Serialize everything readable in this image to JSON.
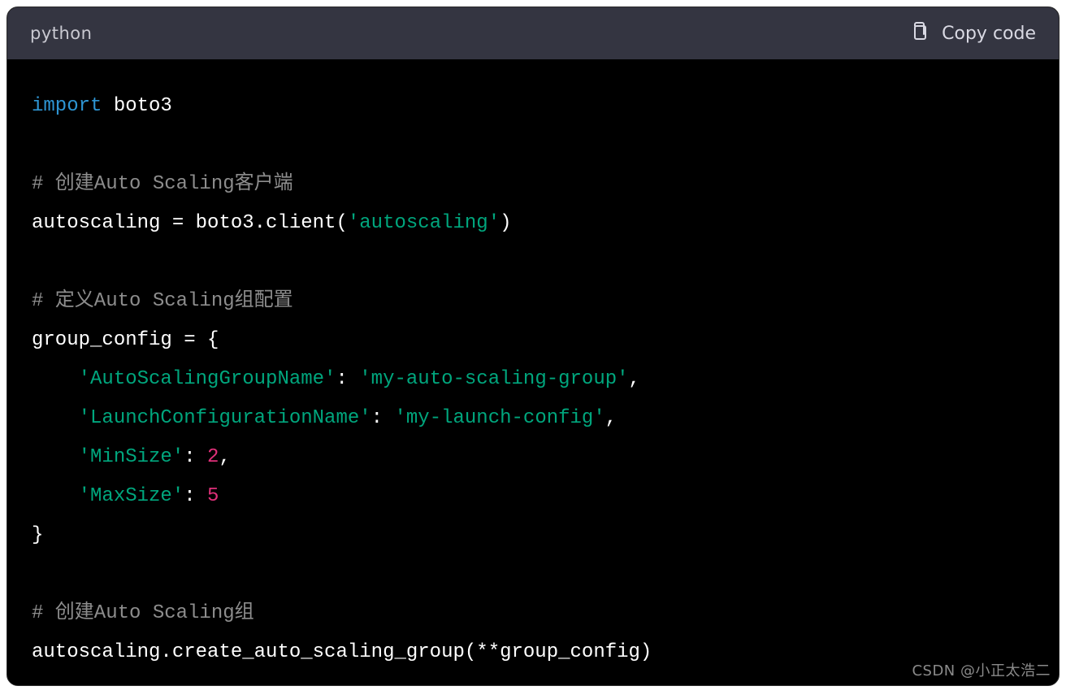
{
  "header": {
    "language": "python",
    "copy_label": "Copy code"
  },
  "code": {
    "l1_kw": "import",
    "l1_mod": " boto3",
    "blank": "",
    "l3_cmt": "# 创建Auto Scaling客户端",
    "l4_a": "autoscaling = boto3.client(",
    "l4_str": "'autoscaling'",
    "l4_b": ")",
    "l6_cmt": "# 定义Auto Scaling组配置",
    "l7": "group_config = {",
    "l8_ind": "    ",
    "l8_k": "'AutoScalingGroupName'",
    "l8_c": ": ",
    "l8_v": "'my-auto-scaling-group'",
    "l8_e": ",",
    "l9_k": "'LaunchConfigurationName'",
    "l9_c": ": ",
    "l9_v": "'my-launch-config'",
    "l9_e": ",",
    "l10_k": "'MinSize'",
    "l10_c": ": ",
    "l10_v": "2",
    "l10_e": ",",
    "l11_k": "'MaxSize'",
    "l11_c": ": ",
    "l11_v": "5",
    "l12": "}",
    "l14_cmt": "# 创建Auto Scaling组",
    "l15": "autoscaling.create_auto_scaling_group(**group_config)"
  },
  "watermark": "CSDN @小正太浩二"
}
